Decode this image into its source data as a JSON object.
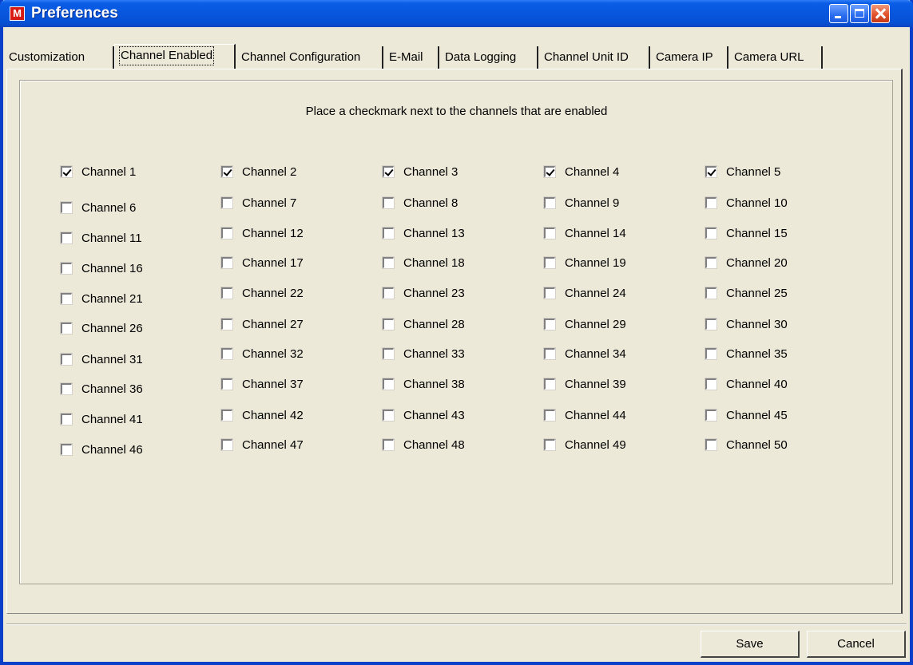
{
  "window": {
    "title": "Preferences",
    "app_icon_letter": "M"
  },
  "tabs": [
    {
      "label": "Customization",
      "active": false
    },
    {
      "label": "Channel Enabled",
      "active": true
    },
    {
      "label": "Channel Configuration",
      "active": false
    },
    {
      "label": "E-Mail",
      "active": false
    },
    {
      "label": "Data Logging",
      "active": false
    },
    {
      "label": "Channel Unit ID",
      "active": false
    },
    {
      "label": "Camera IP",
      "active": false
    },
    {
      "label": "Camera URL",
      "active": false
    }
  ],
  "instruction": "Place a checkmark next to the channels that are enabled",
  "channels": [
    {
      "label": "Channel 1",
      "checked": true
    },
    {
      "label": "Channel 2",
      "checked": true
    },
    {
      "label": "Channel 3",
      "checked": true
    },
    {
      "label": "Channel 4",
      "checked": true
    },
    {
      "label": "Channel 5",
      "checked": true
    },
    {
      "label": "Channel 6",
      "checked": false
    },
    {
      "label": "Channel 7",
      "checked": false
    },
    {
      "label": "Channel 8",
      "checked": false
    },
    {
      "label": "Channel 9",
      "checked": false
    },
    {
      "label": "Channel 10",
      "checked": false
    },
    {
      "label": "Channel 11",
      "checked": false
    },
    {
      "label": "Channel 12",
      "checked": false
    },
    {
      "label": "Channel 13",
      "checked": false
    },
    {
      "label": "Channel 14",
      "checked": false
    },
    {
      "label": "Channel 15",
      "checked": false
    },
    {
      "label": "Channel 16",
      "checked": false
    },
    {
      "label": "Channel 17",
      "checked": false
    },
    {
      "label": "Channel 18",
      "checked": false
    },
    {
      "label": "Channel 19",
      "checked": false
    },
    {
      "label": "Channel 20",
      "checked": false
    },
    {
      "label": "Channel 21",
      "checked": false
    },
    {
      "label": "Channel 22",
      "checked": false
    },
    {
      "label": "Channel 23",
      "checked": false
    },
    {
      "label": "Channel 24",
      "checked": false
    },
    {
      "label": "Channel 25",
      "checked": false
    },
    {
      "label": "Channel 26",
      "checked": false
    },
    {
      "label": "Channel 27",
      "checked": false
    },
    {
      "label": "Channel 28",
      "checked": false
    },
    {
      "label": "Channel 29",
      "checked": false
    },
    {
      "label": "Channel 30",
      "checked": false
    },
    {
      "label": "Channel 31",
      "checked": false
    },
    {
      "label": "Channel 32",
      "checked": false
    },
    {
      "label": "Channel 33",
      "checked": false
    },
    {
      "label": "Channel 34",
      "checked": false
    },
    {
      "label": "Channel 35",
      "checked": false
    },
    {
      "label": "Channel 36",
      "checked": false
    },
    {
      "label": "Channel 37",
      "checked": false
    },
    {
      "label": "Channel 38",
      "checked": false
    },
    {
      "label": "Channel 39",
      "checked": false
    },
    {
      "label": "Channel 40",
      "checked": false
    },
    {
      "label": "Channel 41",
      "checked": false
    },
    {
      "label": "Channel 42",
      "checked": false
    },
    {
      "label": "Channel 43",
      "checked": false
    },
    {
      "label": "Channel 44",
      "checked": false
    },
    {
      "label": "Channel 45",
      "checked": false
    },
    {
      "label": "Channel 46",
      "checked": false
    },
    {
      "label": "Channel 47",
      "checked": false
    },
    {
      "label": "Channel 48",
      "checked": false
    },
    {
      "label": "Channel 49",
      "checked": false
    },
    {
      "label": "Channel 50",
      "checked": false
    }
  ],
  "buttons": {
    "save_label": "Save",
    "cancel_label": "Cancel"
  }
}
